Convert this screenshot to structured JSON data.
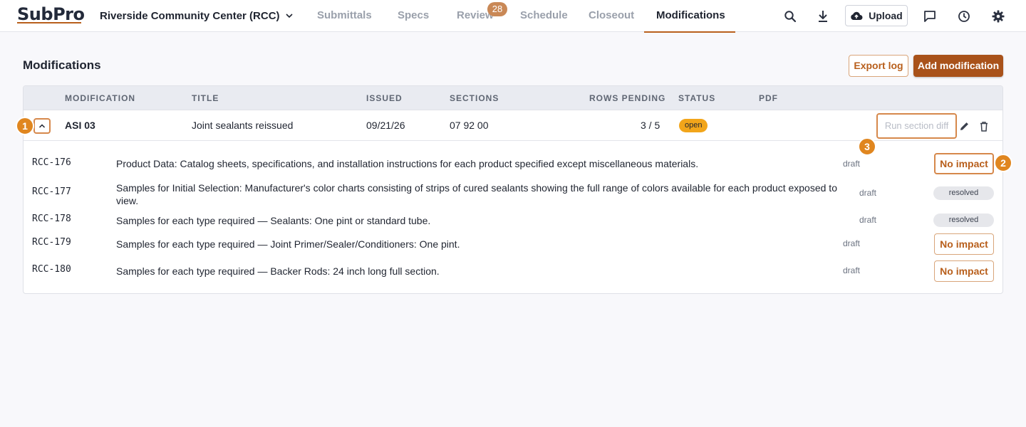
{
  "brand": {
    "logo_sub": "Sub",
    "logo_pro": "Pro",
    "accent": "#b85f1c"
  },
  "project": {
    "name": "Riverside Community Center (RCC)"
  },
  "nav": {
    "tabs": [
      {
        "label": "Submittals"
      },
      {
        "label": "Specs"
      },
      {
        "label": "Review",
        "badge": "28"
      },
      {
        "label": "Schedule"
      },
      {
        "label": "Closeout"
      },
      {
        "label": "Modifications",
        "active": true
      }
    ],
    "upload_label": "Upload",
    "icons": [
      "search-icon",
      "download-icon",
      "cloud-upload-icon",
      "chat-icon",
      "history-icon",
      "settings-icon"
    ]
  },
  "page": {
    "title": "Modifications",
    "export_label": "Export log",
    "add_label": "Add modification"
  },
  "table": {
    "headers": [
      "MODIFICATION",
      "TITLE",
      "ISSUED",
      "SECTIONS",
      "ROWS PENDING",
      "STATUS",
      "PDF"
    ],
    "row": {
      "modification": "ASI 03",
      "title": "Joint sealants reissued",
      "issued": "09/21/26",
      "sections": "07 92 00",
      "rows_pending": "3 / 5",
      "status": "open",
      "run_diff_label": "Run section diff"
    },
    "items": [
      {
        "code": "RCC-176",
        "text": "Product Data: Catalog sheets, specifications, and installation instructions for each product specified except miscellaneous materials.",
        "state": "draft",
        "action": "No impact"
      },
      {
        "code": "RCC-177",
        "text": "Samples for Initial Selection: Manufacturer's color charts consisting of strips of cured sealants showing the full range of colors available for each product exposed to view.",
        "state": "draft",
        "resolution": "resolved"
      },
      {
        "code": "RCC-178",
        "text": "Samples for each type required — Sealants: One pint or standard tube.",
        "state": "draft",
        "resolution": "resolved"
      },
      {
        "code": "RCC-179",
        "text": "Samples for each type required — Joint Primer/Sealer/Conditioners: One pint.",
        "state": "draft",
        "action": "No impact"
      },
      {
        "code": "RCC-180",
        "text": "Samples for each type required — Backer Rods: 24 inch long full section.",
        "state": "draft",
        "action": "No impact"
      }
    ]
  },
  "markers": [
    "1",
    "2",
    "3"
  ]
}
